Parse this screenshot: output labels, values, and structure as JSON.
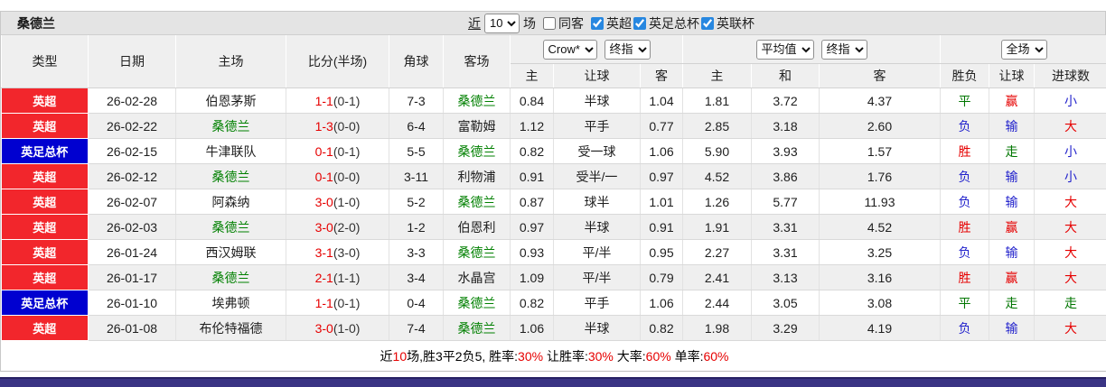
{
  "title": "桑德兰",
  "controls": {
    "near_label": "近",
    "near_value": "10",
    "games_label": "场",
    "same_away": {
      "label": "同客",
      "checked": false
    },
    "filters": [
      {
        "label": "英超",
        "checked": true
      },
      {
        "label": "英足总杯",
        "checked": true
      },
      {
        "label": "英联杯",
        "checked": true
      }
    ]
  },
  "selectors": {
    "asia_company": "Crow*",
    "asia_index": "终指",
    "euro_company": "平均值",
    "euro_index": "终指",
    "scope": "全场"
  },
  "columns": {
    "type": "类型",
    "date": "日期",
    "home": "主场",
    "score": "比分(半场)",
    "corner": "角球",
    "away": "客场",
    "asia_home": "主",
    "asia_handicap": "让球",
    "asia_away": "客",
    "euro_home": "主",
    "euro_draw": "和",
    "euro_away": "客",
    "result": "胜负",
    "handicap_result": "让球",
    "goals": "进球数"
  },
  "colors": {
    "league_red": "#f2262c",
    "cup_blue": "#0000d0",
    "tracked_team_green": "#008000",
    "win_red": "#e60000",
    "draw_green": "#007600",
    "loss_blue": "#2323cc",
    "asia_bg": "#fdf8f1",
    "euro_bg": "#e9f4fb",
    "bottom_bar": "#3a3484"
  },
  "rows": [
    {
      "type": "英超",
      "type_color": "red",
      "date": "26-02-28",
      "home": "伯恩茅斯",
      "home_green": false,
      "score_ft": "1-1",
      "score_ht": "(0-1)",
      "corner": "7-3",
      "away": "桑德兰",
      "away_green": true,
      "asia_home": "0.84",
      "asia_handicap": "半球",
      "asia_away": "1.04",
      "euro_home": "1.81",
      "euro_draw": "3.72",
      "euro_away": "4.37",
      "result": "平",
      "result_color": "green",
      "handicap": "赢",
      "handicap_color": "red",
      "goals": "小",
      "goals_color": "blue"
    },
    {
      "type": "英超",
      "type_color": "red",
      "date": "26-02-22",
      "home": "桑德兰",
      "home_green": true,
      "score_ft": "1-3",
      "score_ht": "(0-0)",
      "corner": "6-4",
      "away": "富勒姆",
      "away_green": false,
      "asia_home": "1.12",
      "asia_handicap": "平手",
      "asia_away": "0.77",
      "euro_home": "2.85",
      "euro_draw": "3.18",
      "euro_away": "2.60",
      "result": "负",
      "result_color": "blue",
      "handicap": "输",
      "handicap_color": "blue",
      "goals": "大",
      "goals_color": "red"
    },
    {
      "type": "英足总杯",
      "type_color": "blue",
      "date": "26-02-15",
      "home": "牛津联队",
      "home_green": false,
      "score_ft": "0-1",
      "score_ht": "(0-1)",
      "corner": "5-5",
      "away": "桑德兰",
      "away_green": true,
      "asia_home": "0.82",
      "asia_handicap": "受一球",
      "asia_away": "1.06",
      "euro_home": "5.90",
      "euro_draw": "3.93",
      "euro_away": "1.57",
      "result": "胜",
      "result_color": "red",
      "handicap": "走",
      "handicap_color": "green",
      "goals": "小",
      "goals_color": "blue"
    },
    {
      "type": "英超",
      "type_color": "red",
      "date": "26-02-12",
      "home": "桑德兰",
      "home_green": true,
      "score_ft": "0-1",
      "score_ht": "(0-0)",
      "corner": "3-11",
      "away": "利物浦",
      "away_green": false,
      "asia_home": "0.91",
      "asia_handicap": "受半/一",
      "asia_away": "0.97",
      "euro_home": "4.52",
      "euro_draw": "3.86",
      "euro_away": "1.76",
      "result": "负",
      "result_color": "blue",
      "handicap": "输",
      "handicap_color": "blue",
      "goals": "小",
      "goals_color": "blue"
    },
    {
      "type": "英超",
      "type_color": "red",
      "date": "26-02-07",
      "home": "阿森纳",
      "home_green": false,
      "score_ft": "3-0",
      "score_ht": "(1-0)",
      "corner": "5-2",
      "away": "桑德兰",
      "away_green": true,
      "asia_home": "0.87",
      "asia_handicap": "球半",
      "asia_away": "1.01",
      "euro_home": "1.26",
      "euro_draw": "5.77",
      "euro_away": "11.93",
      "result": "负",
      "result_color": "blue",
      "handicap": "输",
      "handicap_color": "blue",
      "goals": "大",
      "goals_color": "red"
    },
    {
      "type": "英超",
      "type_color": "red",
      "date": "26-02-03",
      "home": "桑德兰",
      "home_green": true,
      "score_ft": "3-0",
      "score_ht": "(2-0)",
      "corner": "1-2",
      "away": "伯恩利",
      "away_green": false,
      "asia_home": "0.97",
      "asia_handicap": "半球",
      "asia_away": "0.91",
      "euro_home": "1.91",
      "euro_draw": "3.31",
      "euro_away": "4.52",
      "result": "胜",
      "result_color": "red",
      "handicap": "赢",
      "handicap_color": "red",
      "goals": "大",
      "goals_color": "red"
    },
    {
      "type": "英超",
      "type_color": "red",
      "date": "26-01-24",
      "home": "西汉姆联",
      "home_green": false,
      "score_ft": "3-1",
      "score_ht": "(3-0)",
      "corner": "3-3",
      "away": "桑德兰",
      "away_green": true,
      "asia_home": "0.93",
      "asia_handicap": "平/半",
      "asia_away": "0.95",
      "euro_home": "2.27",
      "euro_draw": "3.31",
      "euro_away": "3.25",
      "result": "负",
      "result_color": "blue",
      "handicap": "输",
      "handicap_color": "blue",
      "goals": "大",
      "goals_color": "red"
    },
    {
      "type": "英超",
      "type_color": "red",
      "date": "26-01-17",
      "home": "桑德兰",
      "home_green": true,
      "score_ft": "2-1",
      "score_ht": "(1-1)",
      "corner": "3-4",
      "away": "水晶宫",
      "away_green": false,
      "asia_home": "1.09",
      "asia_handicap": "平/半",
      "asia_away": "0.79",
      "euro_home": "2.41",
      "euro_draw": "3.13",
      "euro_away": "3.16",
      "result": "胜",
      "result_color": "red",
      "handicap": "赢",
      "handicap_color": "red",
      "goals": "大",
      "goals_color": "red"
    },
    {
      "type": "英足总杯",
      "type_color": "blue",
      "date": "26-01-10",
      "home": "埃弗顿",
      "home_green": false,
      "score_ft": "1-1",
      "score_ht": "(0-1)",
      "corner": "0-4",
      "away": "桑德兰",
      "away_green": true,
      "asia_home": "0.82",
      "asia_handicap": "平手",
      "asia_away": "1.06",
      "euro_home": "2.44",
      "euro_draw": "3.05",
      "euro_away": "3.08",
      "result": "平",
      "result_color": "green",
      "handicap": "走",
      "handicap_color": "green",
      "goals": "走",
      "goals_color": "green"
    },
    {
      "type": "英超",
      "type_color": "red",
      "date": "26-01-08",
      "home": "布伦特福德",
      "home_green": false,
      "score_ft": "3-0",
      "score_ht": "(1-0)",
      "corner": "7-4",
      "away": "桑德兰",
      "away_green": true,
      "asia_home": "1.06",
      "asia_handicap": "半球",
      "asia_away": "0.82",
      "euro_home": "1.98",
      "euro_draw": "3.29",
      "euro_away": "4.19",
      "result": "负",
      "result_color": "blue",
      "handicap": "输",
      "handicap_color": "blue",
      "goals": "大",
      "goals_color": "red"
    }
  ],
  "summary": [
    {
      "text": "近",
      "color": "black"
    },
    {
      "text": "10",
      "color": "red"
    },
    {
      "text": "场,胜3平2负5, 胜率:",
      "color": "black"
    },
    {
      "text": "30%",
      "color": "red"
    },
    {
      "text": " 让胜率:",
      "color": "black"
    },
    {
      "text": "30%",
      "color": "red"
    },
    {
      "text": " 大率:",
      "color": "black"
    },
    {
      "text": "60%",
      "color": "red"
    },
    {
      "text": " 单率:",
      "color": "black"
    },
    {
      "text": "60%",
      "color": "red"
    }
  ]
}
